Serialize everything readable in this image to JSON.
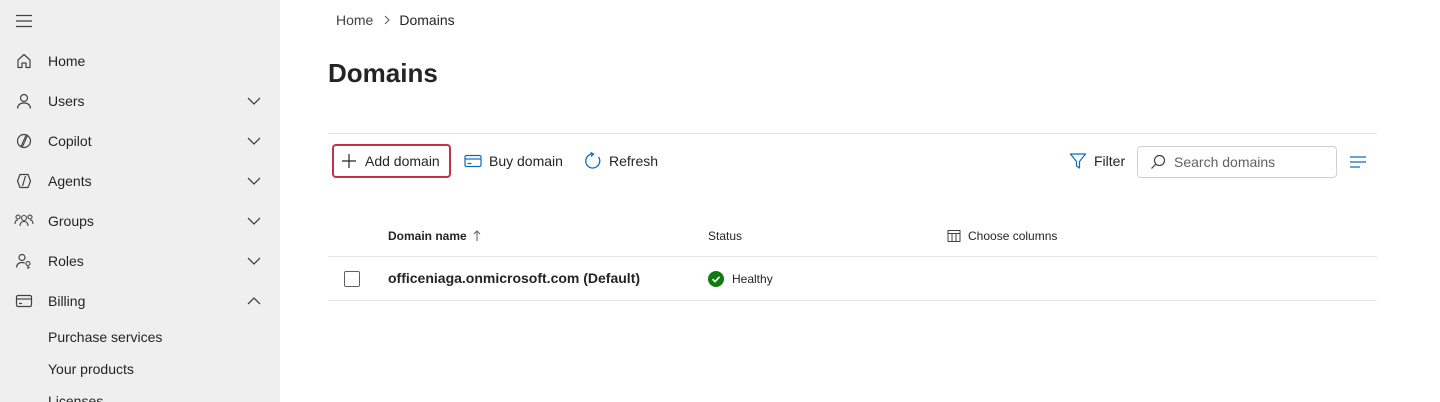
{
  "sidebar": {
    "nav": [
      {
        "label": "Home",
        "icon": "home-icon",
        "expandable": false
      },
      {
        "label": "Users",
        "icon": "user-icon",
        "expandable": true,
        "expanded": false
      },
      {
        "label": "Copilot",
        "icon": "copilot-icon",
        "expandable": true,
        "expanded": false
      },
      {
        "label": "Agents",
        "icon": "agents-icon",
        "expandable": true,
        "expanded": false
      },
      {
        "label": "Groups",
        "icon": "groups-icon",
        "expandable": true,
        "expanded": false
      },
      {
        "label": "Roles",
        "icon": "roles-icon",
        "expandable": true,
        "expanded": false
      },
      {
        "label": "Billing",
        "icon": "billing-icon",
        "expandable": true,
        "expanded": true
      }
    ],
    "billing_subitems": [
      "Purchase services",
      "Your products",
      "Licenses"
    ]
  },
  "breadcrumb": {
    "home": "Home",
    "current": "Domains"
  },
  "page": {
    "title": "Domains"
  },
  "toolbar": {
    "add_domain": "Add domain",
    "buy_domain": "Buy domain",
    "refresh": "Refresh",
    "filter": "Filter",
    "search_placeholder": "Search domains"
  },
  "table": {
    "columns": {
      "name": "Domain name",
      "status": "Status",
      "choose_columns": "Choose columns"
    },
    "rows": [
      {
        "name": "officeniaga.onmicrosoft.com (Default)",
        "status": "Healthy"
      }
    ]
  },
  "colors": {
    "sidebar_bg": "#efefef",
    "accent": "#0f6cbd",
    "highlight_border": "#c4314b",
    "healthy": "#107c10"
  }
}
